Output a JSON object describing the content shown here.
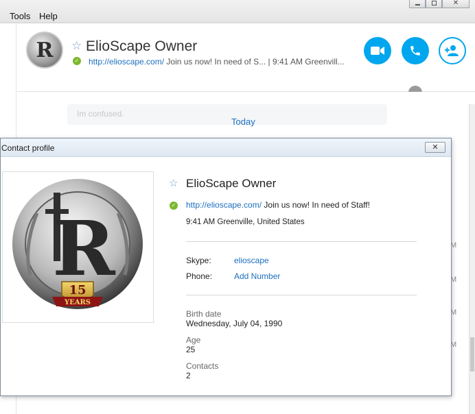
{
  "menubar": {
    "tools": "Tools",
    "help": "Help"
  },
  "conversation": {
    "avatar_letter": "R",
    "name": "ElioScape Owner",
    "mood_link": "http://elioscape.com/",
    "mood_text": " Join us now! In need of S...  | 9:41 AM Greenvill...",
    "today": "Today",
    "faded_message": "Im confused.",
    "side_letter": "M"
  },
  "dialog": {
    "title": "Contact profile",
    "name": "ElioScape Owner",
    "mood_link": "http://elioscape.com/",
    "mood_text": " Join us now! In need of Staff!",
    "location": "9:41 AM Greenville, United States",
    "skype_label": "Skype:",
    "skype_value": "elioscape",
    "phone_label": "Phone:",
    "phone_value": "Add Number",
    "birth_label": "Birth date",
    "birth_value": "Wednesday, July 04, 1990",
    "age_label": "Age",
    "age_value": "25",
    "contacts_label": "Contacts",
    "contacts_value": "2",
    "badge_number": "15",
    "badge_text": "YEARS"
  },
  "colors": {
    "accent": "#00a6ee",
    "link": "#1c6fbf",
    "online": "#7cb82f"
  }
}
